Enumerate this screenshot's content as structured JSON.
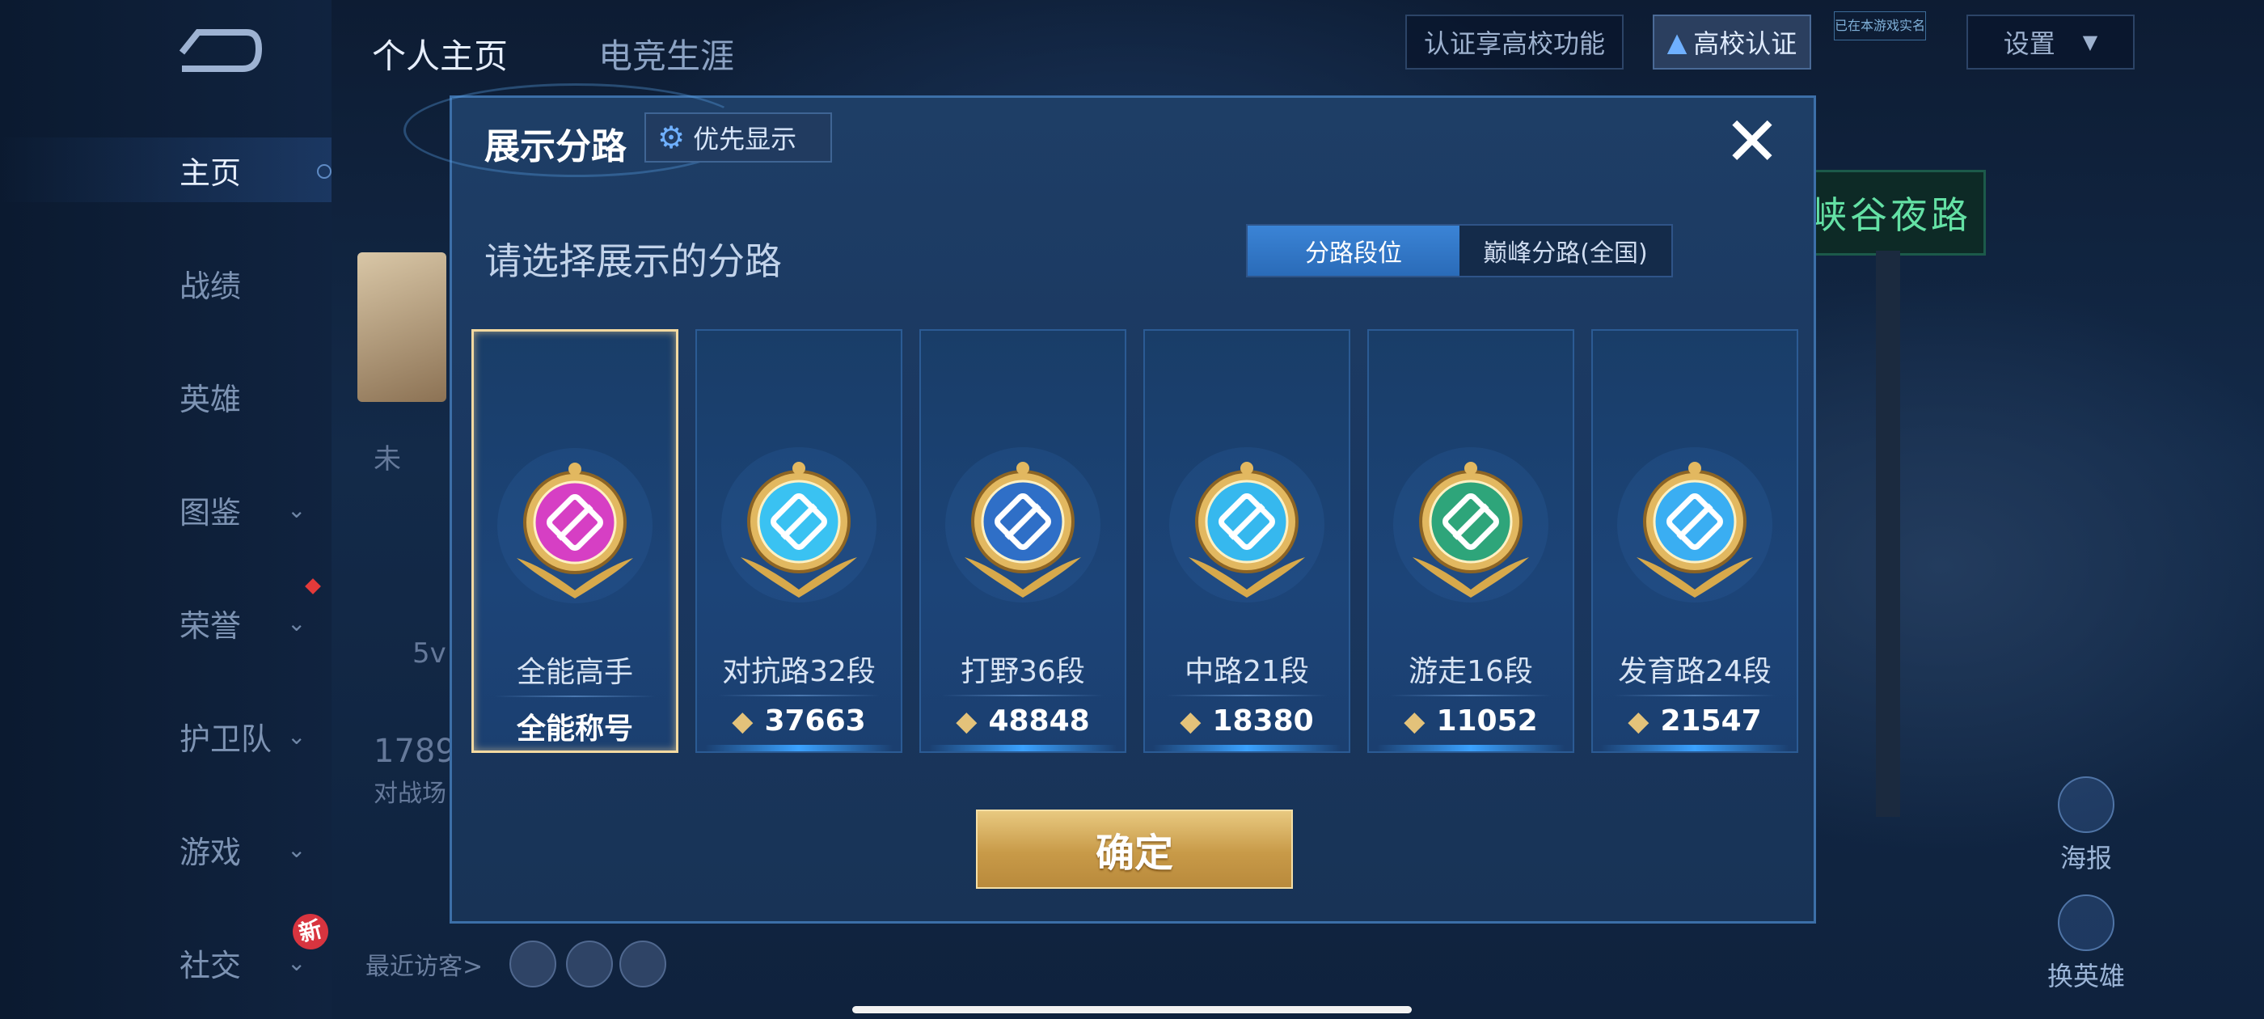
{
  "background": {
    "tabs": [
      "个人主页",
      "电竞生涯"
    ],
    "cert_prompt": "认证享高校功能",
    "cert_button": "高校认证",
    "cert_tag": "已在本游戏实名",
    "settings_label": "设置",
    "sidebar": [
      {
        "label": "主页",
        "chevron": false
      },
      {
        "label": "战绩",
        "chevron": false
      },
      {
        "label": "英雄",
        "chevron": false
      },
      {
        "label": "图鉴",
        "chevron": true
      },
      {
        "label": "荣誉",
        "chevron": true
      },
      {
        "label": "护卫队",
        "chevron": true
      },
      {
        "label": "游戏",
        "chevron": true
      },
      {
        "label": "社交",
        "chevron": true
      }
    ],
    "new_tag": "新",
    "profile_fragment_1": "未",
    "profile_fragment_2": "5v",
    "profile_fragment_3": "1789",
    "profile_fragment_4": "对战场",
    "recent_visitors_label": "最近访客>",
    "poster_label": "海报",
    "change_hero_label": "换英雄"
  },
  "modal": {
    "title": "展示分路",
    "priority_label": "优先显示",
    "subtitle": "请选择展示的分路",
    "toggle": [
      "分路段位",
      "巅峰分路(全国)"
    ],
    "cards": [
      {
        "name": "全能高手",
        "value": "全能称号",
        "selected": true,
        "color": "#d63fc4",
        "icon": "allround-emblem"
      },
      {
        "name": "对抗路32段",
        "value": "37663",
        "selected": false,
        "color": "#3ac2f2",
        "icon": "clash-lane-emblem"
      },
      {
        "name": "打野36段",
        "value": "48848",
        "selected": false,
        "color": "#2f6fc7",
        "icon": "jungle-emblem"
      },
      {
        "name": "中路21段",
        "value": "18380",
        "selected": false,
        "color": "#36b8ee",
        "icon": "mid-lane-emblem"
      },
      {
        "name": "游走16段",
        "value": "11052",
        "selected": false,
        "color": "#2ea57a",
        "icon": "roam-emblem"
      },
      {
        "name": "发育路24段",
        "value": "21547",
        "selected": false,
        "color": "#3aaef2",
        "icon": "farm-lane-emblem"
      }
    ],
    "confirm_label": "确定"
  }
}
